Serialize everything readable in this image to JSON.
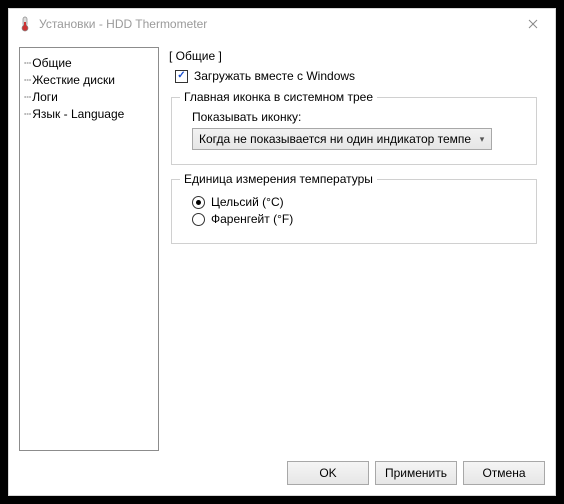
{
  "window": {
    "title": "Установки - HDD Thermometer"
  },
  "nav": {
    "items": [
      {
        "label": "Общие"
      },
      {
        "label": "Жесткие диски"
      },
      {
        "label": "Логи"
      },
      {
        "label": "Язык - Language"
      }
    ]
  },
  "main": {
    "section_title": "[ Общие ]",
    "startup_checkbox": {
      "label": "Загружать вместе с Windows",
      "checked": true
    },
    "tray_group": {
      "legend": "Главная иконка в системном трее",
      "show_icon_label": "Показывать иконку:",
      "dropdown_value": "Когда не показывается ни один индикатор темпе"
    },
    "unit_group": {
      "legend": "Единица измерения температуры",
      "options": [
        {
          "label": "Цельсий (°C)",
          "checked": true
        },
        {
          "label": "Фаренгейт (°F)",
          "checked": false
        }
      ]
    }
  },
  "buttons": {
    "ok": "OK",
    "apply": "Применить",
    "cancel": "Отмена"
  }
}
